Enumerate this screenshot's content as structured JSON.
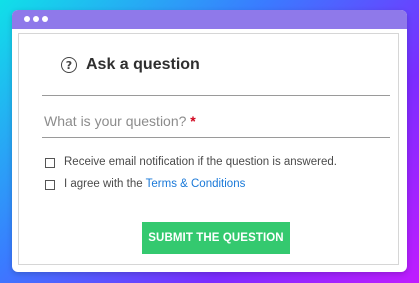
{
  "colors": {
    "titlebar": "#8f79ea",
    "submit_bg": "#34c96f",
    "link": "#1a79d8",
    "required": "#d0021b"
  },
  "form": {
    "icon": "question-circle-icon",
    "icon_glyph": "?",
    "title": "Ask a question",
    "question_placeholder": "What is your question?",
    "required_mark": "*",
    "options": [
      {
        "label": "Receive email notification if the question is answered."
      },
      {
        "label": "I agree with the",
        "link": "Terms & Conditions"
      }
    ],
    "submit_label": "SUBMIT THE QUESTION"
  }
}
